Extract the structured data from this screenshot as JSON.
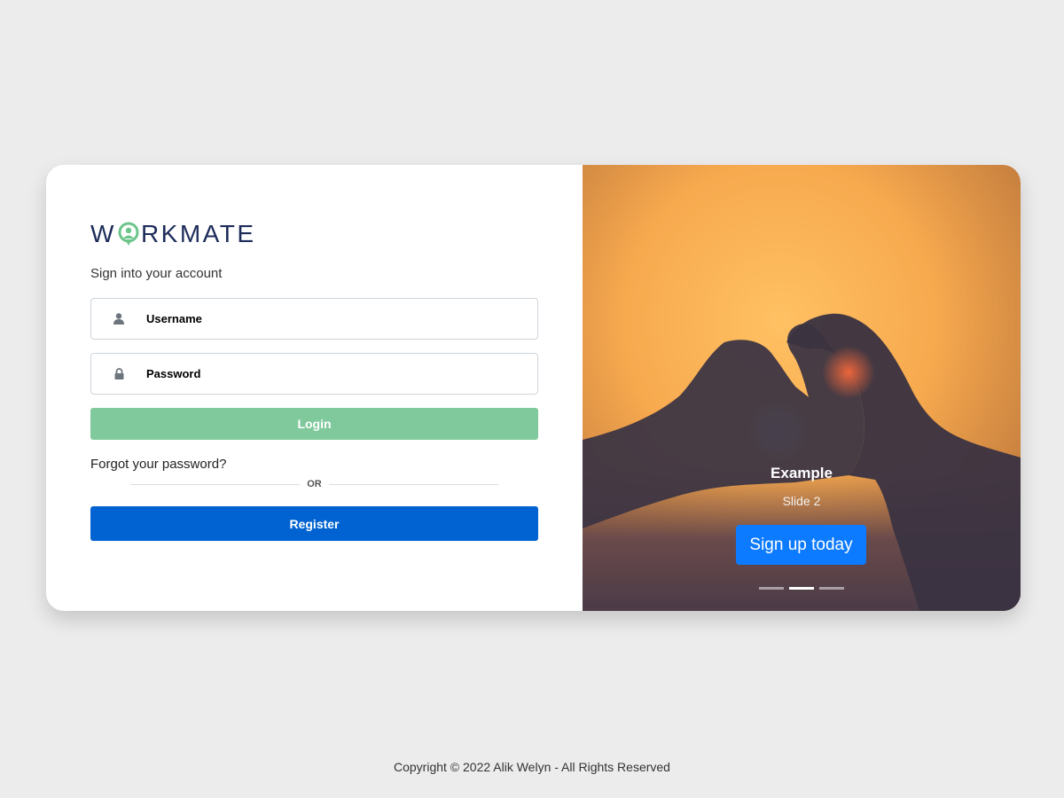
{
  "brand": {
    "logo_left": "W",
    "logo_right": "RKMATE",
    "logo_color": "#1c2b59",
    "logo_accent": "#6cc58b"
  },
  "login": {
    "subtitle": "Sign into your account",
    "username_placeholder": "Username",
    "password_placeholder": "Password",
    "login_label": "Login",
    "forgot_label": "Forgot your password?",
    "or_label": "OR",
    "register_label": "Register",
    "user_icon": "user-icon",
    "lock_icon": "lock-icon"
  },
  "carousel": {
    "caption_title": "Example",
    "caption_subtitle": "Slide 2",
    "cta_label": "Sign up today",
    "active_slide": 2,
    "slide_count": 3
  },
  "footer": {
    "copyright": "Copyright © 2022 Alik Welyn - All Rights Reserved"
  },
  "colors": {
    "background": "#ececec",
    "login_button": "#80c99c",
    "register_button": "#0063d1",
    "cta_button": "#0d7bff"
  }
}
